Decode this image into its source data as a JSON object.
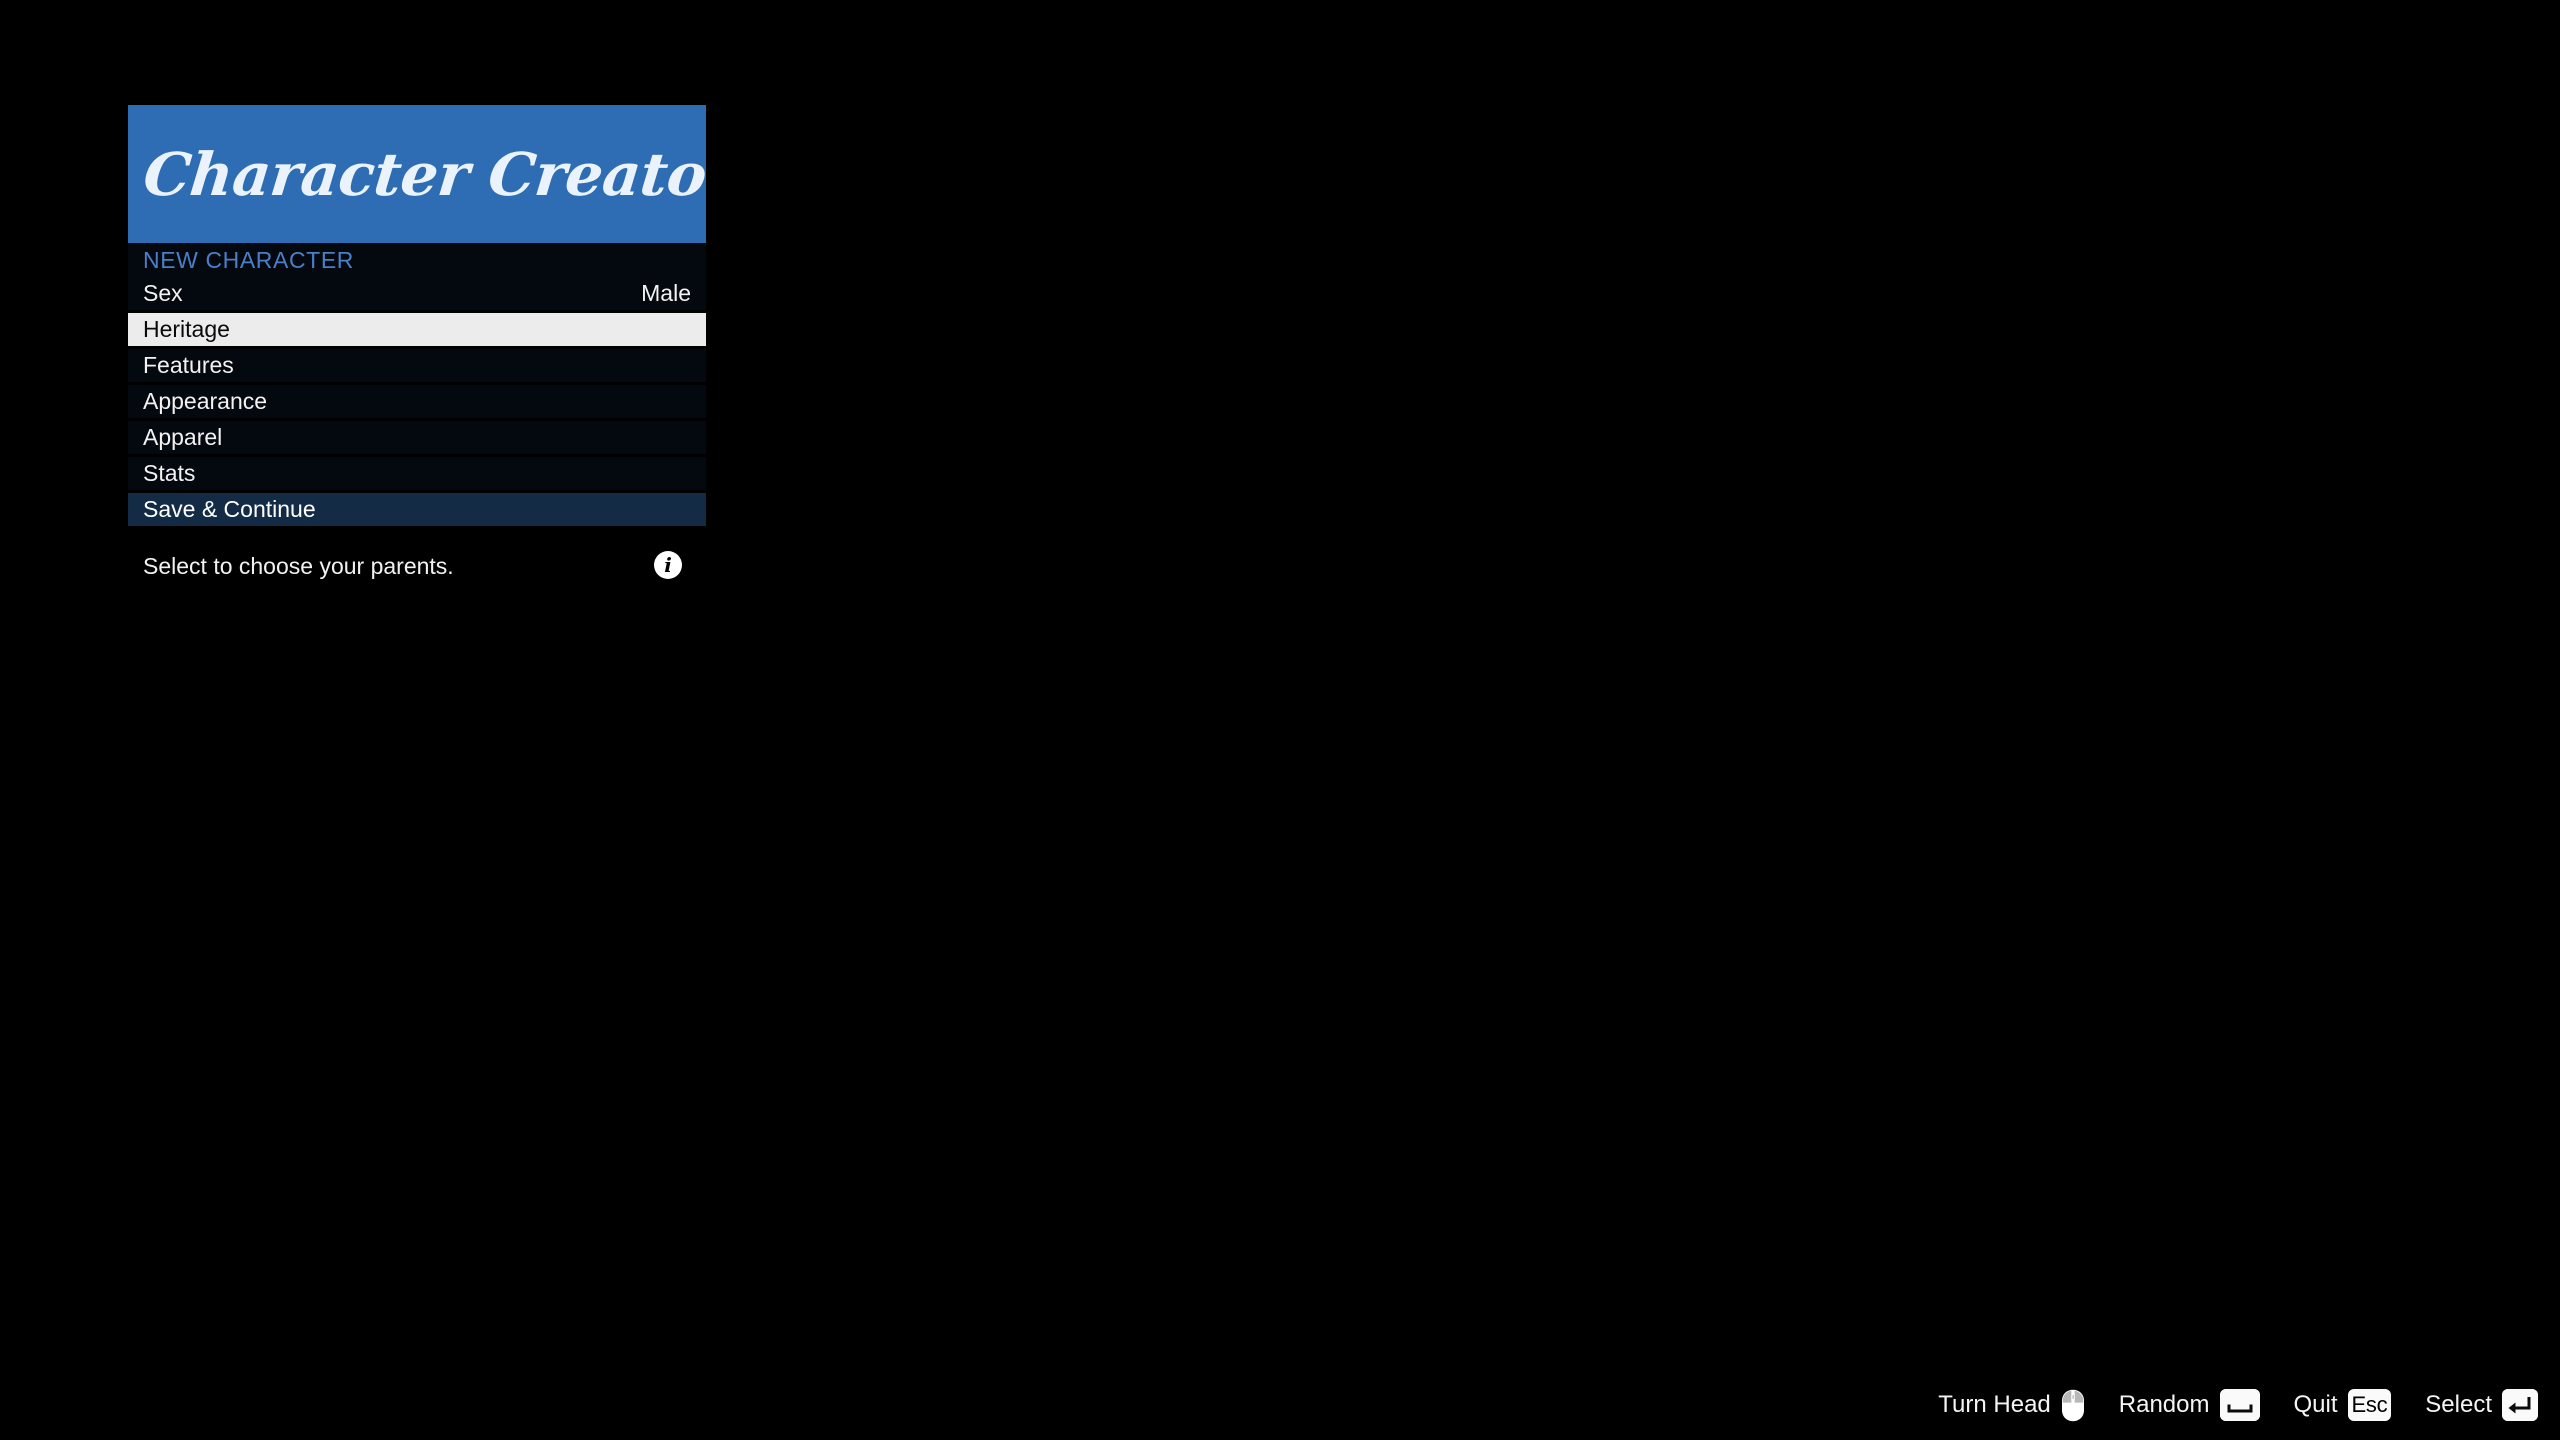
{
  "app": {
    "title": "Character Creator",
    "background_color": "#000000",
    "banner_color": "#2e6db4"
  },
  "panel": {
    "section_label": "NEW CHARACTER",
    "section_label_color": "#4a7fc8",
    "selected_color": "#ececec",
    "accent_color": "#132b44",
    "rows": [
      {
        "label": "Sex",
        "value": "Male",
        "state": "normal"
      },
      {
        "label": "Heritage",
        "value": "",
        "state": "selected"
      },
      {
        "label": "Features",
        "value": "",
        "state": "normal"
      },
      {
        "label": "Appearance",
        "value": "",
        "state": "normal"
      },
      {
        "label": "Apparel",
        "value": "",
        "state": "normal"
      },
      {
        "label": "Stats",
        "value": "",
        "state": "normal"
      },
      {
        "label": "Save & Continue",
        "value": "",
        "state": "accent"
      }
    ],
    "hint": {
      "text": "Select to choose your parents.",
      "info_icon": "info-icon",
      "info_glyph": "i"
    }
  },
  "control_bar": {
    "hints": [
      {
        "label": "Turn Head",
        "icon": "mouse-icon",
        "key": ""
      },
      {
        "label": "Random",
        "icon": "spacebar-key",
        "key": ""
      },
      {
        "label": "Quit",
        "icon": "escape-key",
        "key": "Esc"
      },
      {
        "label": "Select",
        "icon": "enter-key",
        "key": ""
      }
    ]
  }
}
